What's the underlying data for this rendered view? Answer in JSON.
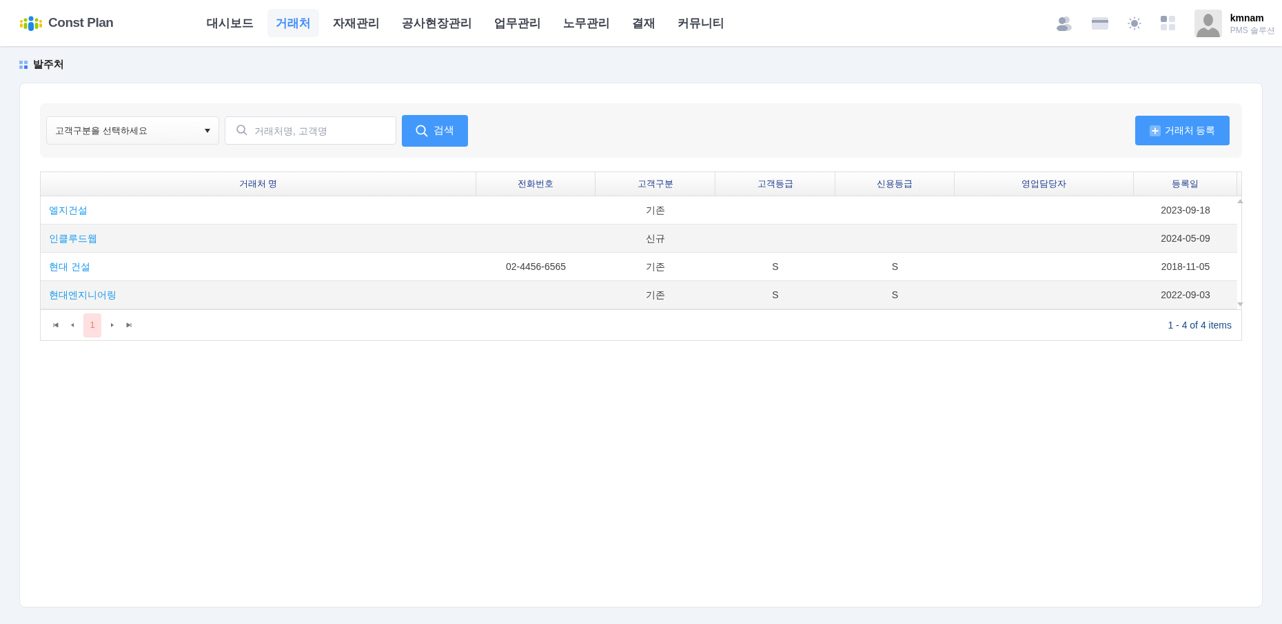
{
  "header": {
    "logo": "Const Plan",
    "nav": [
      {
        "label": "대시보드",
        "selected": false
      },
      {
        "label": "거래처",
        "selected": true
      },
      {
        "label": "자재관리",
        "selected": false
      },
      {
        "label": "공사현장관리",
        "selected": false
      },
      {
        "label": "업무관리",
        "selected": false
      },
      {
        "label": "노무관리",
        "selected": false
      },
      {
        "label": "결재",
        "selected": false
      },
      {
        "label": "커뮤니티",
        "selected": false
      }
    ],
    "user": {
      "name": "kmnam",
      "subtitle": "PMS 솔루션"
    }
  },
  "page_title": "발주처",
  "toolbar": {
    "category_select": "고객구분을 선택하세요",
    "search": {
      "placeholder": "거래처명, 고객명"
    },
    "search_button": "검색",
    "add_button": "거래처 등록"
  },
  "table": {
    "columns": [
      "거래처 명",
      "전화번호",
      "고객구분",
      "고객등급",
      "신용등급",
      "영업담당자",
      "등록일"
    ],
    "rows": [
      [
        "엘지건설",
        "",
        "기존",
        "",
        "",
        "",
        "2023-09-18"
      ],
      [
        "인클루드웹",
        "",
        "신규",
        "",
        "",
        "",
        "2024-05-09"
      ],
      [
        "현대 건설",
        "02-4456-6565",
        "기존",
        "S",
        "S",
        "",
        "2018-11-05"
      ],
      [
        "현대엔지니어링",
        "",
        "기존",
        "S",
        "S",
        "",
        "2022-09-03"
      ]
    ],
    "pager": {
      "pages": [
        {
          "label": "1",
          "selected": true
        }
      ],
      "summary": "1 - 4 of 4 items"
    }
  }
}
